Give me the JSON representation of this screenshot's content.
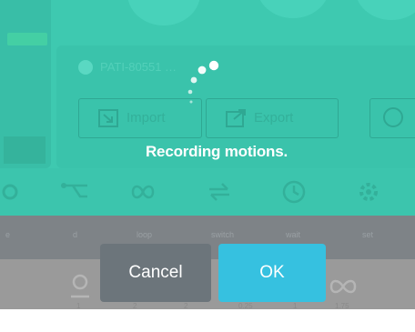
{
  "background_app": {
    "device_id": "PATI-80551 …",
    "actions": {
      "import_label": "Import",
      "export_label": "Export"
    },
    "tool_labels": [
      "e",
      "d",
      "loop",
      "switch",
      "wait",
      "set"
    ],
    "bottom_values": [
      "1",
      "2",
      "2",
      "0.25",
      "1",
      "1.75"
    ]
  },
  "overlay": {
    "status_text": "Recording motions.",
    "cancel_label": "Cancel",
    "ok_label": "OK"
  },
  "colors": {
    "teal": "#3ec9b0",
    "cancel": "#6c757b",
    "ok": "#36c1e0"
  }
}
